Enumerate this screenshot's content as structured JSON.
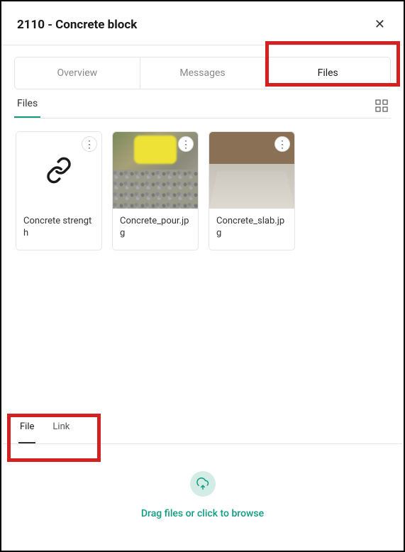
{
  "header": {
    "title": "2110 - Concrete block"
  },
  "tabs": {
    "items": [
      {
        "label": "Overview"
      },
      {
        "label": "Messages"
      },
      {
        "label": "Files"
      }
    ],
    "active_index": 2
  },
  "sub_section": {
    "title": "Files"
  },
  "files": [
    {
      "name": "Concrete strength",
      "type": "link"
    },
    {
      "name": "Concrete_pour.jpg",
      "type": "image"
    },
    {
      "name": "Concrete_slab.jpg",
      "type": "image"
    }
  ],
  "upload_tabs": {
    "items": [
      {
        "label": "File"
      },
      {
        "label": "Link"
      }
    ],
    "active_index": 0
  },
  "upload": {
    "prompt": "Drag files or click to browse"
  },
  "colors": {
    "accent": "#0f9d82",
    "highlight": "#d32020"
  }
}
